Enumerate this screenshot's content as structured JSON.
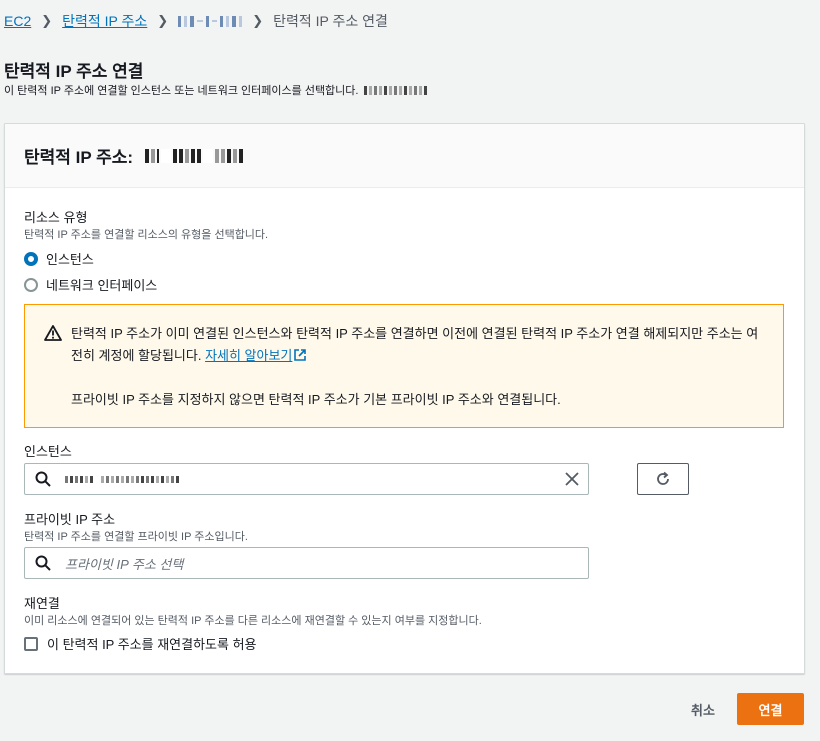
{
  "breadcrumb": {
    "root": "EC2",
    "parent": "탄력적 IP 주소",
    "current": "탄력적 IP 주소 연결"
  },
  "page": {
    "title": "탄력적 IP 주소 연결",
    "description": "이 탄력적 IP 주소에 연결할 인스턴스 또는 네트워크 인터페이스를 선택합니다."
  },
  "panel": {
    "header_label": "탄력적 IP 주소:"
  },
  "resource_type": {
    "label": "리소스 유형",
    "hint": "탄력적 IP 주소를 연결할 리소스의 유형을 선택합니다.",
    "options": [
      "인스턴스",
      "네트워크 인터페이스"
    ],
    "selected": "인스턴스"
  },
  "warning": {
    "text": "탄력적 IP 주소가 이미 연결된 인스턴스와 탄력적 IP 주소를 연결하면 이전에 연결된 탄력적 IP 주소가 연결 해제되지만 주소는 여전히 계정에 할당됩니다.",
    "link": "자세히 알아보기",
    "text2": "프라이빗 IP 주소를 지정하지 않으면 탄력적 IP 주소가 기본 프라이빗 IP 주소와 연결됩니다.",
    "icon": "warning-icon",
    "color": "#ff9900"
  },
  "instance": {
    "label": "인스턴스"
  },
  "private_ip": {
    "label": "프라이빗 IP 주소",
    "hint": "탄력적 IP 주소를 연결할 프라이빗 IP 주소입니다.",
    "placeholder": "프라이빗 IP 주소 선택"
  },
  "reassociation": {
    "label": "재연결",
    "hint": "이미 리소스에 연결되어 있는 탄력적 IP 주소를 다른 리소스에 재연결할 수 있는지 여부를 지정합니다.",
    "checkbox_label": "이 탄력적 IP 주소를 재연결하도록 허용",
    "checked": false
  },
  "actions": {
    "cancel": "취소",
    "submit": "연결"
  },
  "colors": {
    "accent": "#ec7211",
    "link": "#0073bb"
  }
}
